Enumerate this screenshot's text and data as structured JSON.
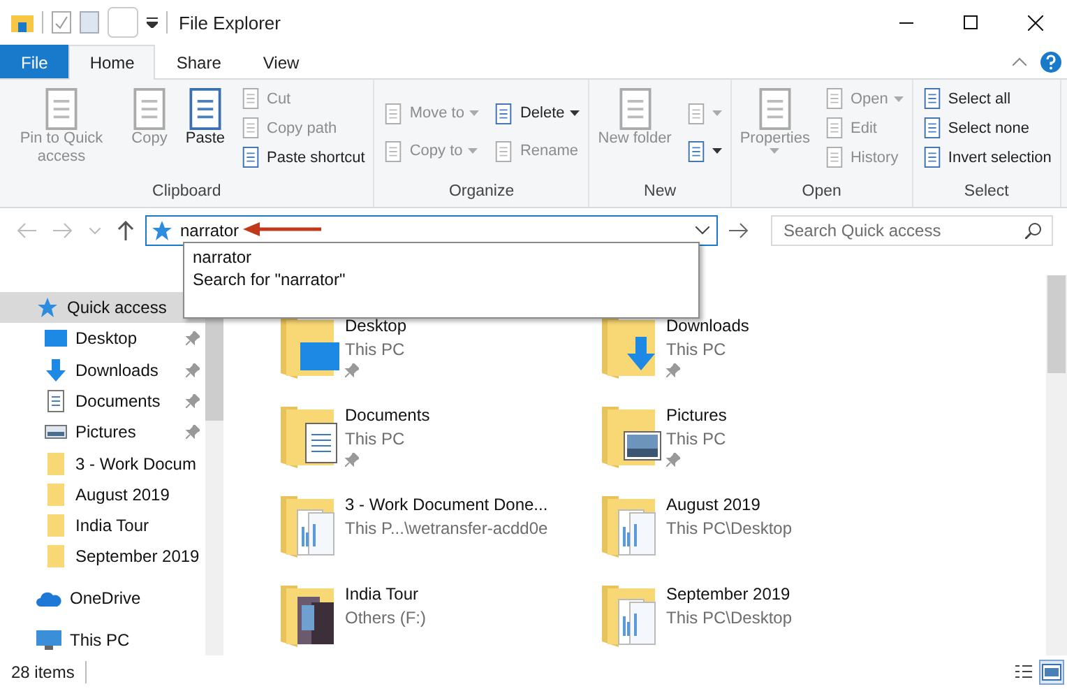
{
  "window": {
    "title": "File Explorer"
  },
  "tabs": [
    {
      "label": "File",
      "kind": "file",
      "selected": false
    },
    {
      "label": "Home",
      "kind": "tab",
      "selected": true
    },
    {
      "label": "Share",
      "kind": "tab",
      "selected": false
    },
    {
      "label": "View",
      "kind": "tab",
      "selected": false
    }
  ],
  "ribbon": [
    {
      "label": "Clipboard",
      "columns": [
        [
          {
            "label": "Pin to Quick access",
            "kind": "large",
            "disabled": true
          }
        ],
        [
          {
            "label": "Copy",
            "kind": "large",
            "disabled": true
          }
        ],
        [
          {
            "label": "Paste",
            "kind": "large",
            "disabled": false
          }
        ],
        [
          {
            "label": "Cut",
            "kind": "small",
            "disabled": true
          },
          {
            "label": "Copy path",
            "kind": "small",
            "disabled": true
          },
          {
            "label": "Paste shortcut",
            "kind": "small",
            "disabled": false
          }
        ]
      ]
    },
    {
      "label": "Organize",
      "columns": [
        [
          {
            "label": "Move to",
            "kind": "small",
            "disabled": true,
            "has_menu": true
          },
          {
            "label": "Copy to",
            "kind": "small",
            "disabled": true,
            "has_menu": true
          }
        ],
        [
          {
            "label": "Delete",
            "kind": "small",
            "disabled": false,
            "has_menu": true
          },
          {
            "label": "Rename",
            "kind": "small",
            "disabled": true
          }
        ]
      ]
    },
    {
      "label": "New",
      "columns": [
        [
          {
            "label": "New folder",
            "kind": "large",
            "disabled": true
          }
        ],
        [
          {
            "kind": "small",
            "disabled": true,
            "has_menu": true
          },
          {
            "kind": "small",
            "disabled": false,
            "has_menu": true
          }
        ]
      ]
    },
    {
      "label": "Open",
      "columns": [
        [
          {
            "label": "Properties",
            "kind": "large",
            "disabled": true,
            "has_menu": true
          }
        ],
        [
          {
            "label": "Open",
            "kind": "small",
            "disabled": true,
            "has_menu": true
          },
          {
            "label": "Edit",
            "kind": "small",
            "disabled": true
          },
          {
            "label": "History",
            "kind": "small",
            "disabled": true
          }
        ]
      ]
    },
    {
      "label": "Select",
      "columns": [
        [
          {
            "label": "Select all",
            "kind": "small",
            "disabled": false
          },
          {
            "label": "Select none",
            "kind": "small",
            "disabled": false
          },
          {
            "label": "Invert selection",
            "kind": "small",
            "disabled": false
          }
        ]
      ]
    }
  ],
  "address": {
    "value": "narrator",
    "suggestions": [
      "narrator",
      "Search for \"narrator\""
    ]
  },
  "search": {
    "placeholder": "Search Quick access"
  },
  "nav": [
    {
      "label": "Quick access",
      "kind": "star",
      "selected": true,
      "children": [
        {
          "label": "Desktop",
          "kind": "desktop",
          "pinned": true
        },
        {
          "label": "Downloads",
          "kind": "download",
          "pinned": true
        },
        {
          "label": "Documents",
          "kind": "document",
          "pinned": true
        },
        {
          "label": "Pictures",
          "kind": "picture",
          "pinned": true
        },
        {
          "label": "3 - Work Docum",
          "kind": "folder",
          "pinned": false
        },
        {
          "label": "August 2019",
          "kind": "folder",
          "pinned": false
        },
        {
          "label": "India Tour",
          "kind": "folder",
          "pinned": false
        },
        {
          "label": "September 2019",
          "kind": "folder",
          "pinned": false
        }
      ]
    },
    {
      "label": "OneDrive",
      "kind": "cloud",
      "selected": false
    },
    {
      "label": "This PC",
      "kind": "pc",
      "selected": false
    }
  ],
  "items": [
    {
      "name": "Desktop",
      "location": "This PC",
      "kind": "desktop",
      "pinned": true
    },
    {
      "name": "Downloads",
      "location": "This PC",
      "kind": "download",
      "pinned": true
    },
    {
      "name": "Documents",
      "location": "This PC",
      "kind": "document",
      "pinned": true
    },
    {
      "name": "Pictures",
      "location": "This PC",
      "kind": "picture",
      "pinned": true
    },
    {
      "name": "3 - Work Document Done...",
      "location": "This P...\\wetransfer-acdd0e",
      "kind": "files",
      "pinned": false
    },
    {
      "name": "August 2019",
      "location": "This PC\\Desktop",
      "kind": "files",
      "pinned": false
    },
    {
      "name": "India Tour",
      "location": "Others (F:)",
      "kind": "photos",
      "pinned": false
    },
    {
      "name": "September 2019",
      "location": "This PC\\Desktop",
      "kind": "files",
      "pinned": false
    }
  ],
  "status_bar": {
    "count": "28 items"
  },
  "views": [
    {
      "kind": "details",
      "selected": false
    },
    {
      "kind": "large",
      "selected": true
    }
  ]
}
